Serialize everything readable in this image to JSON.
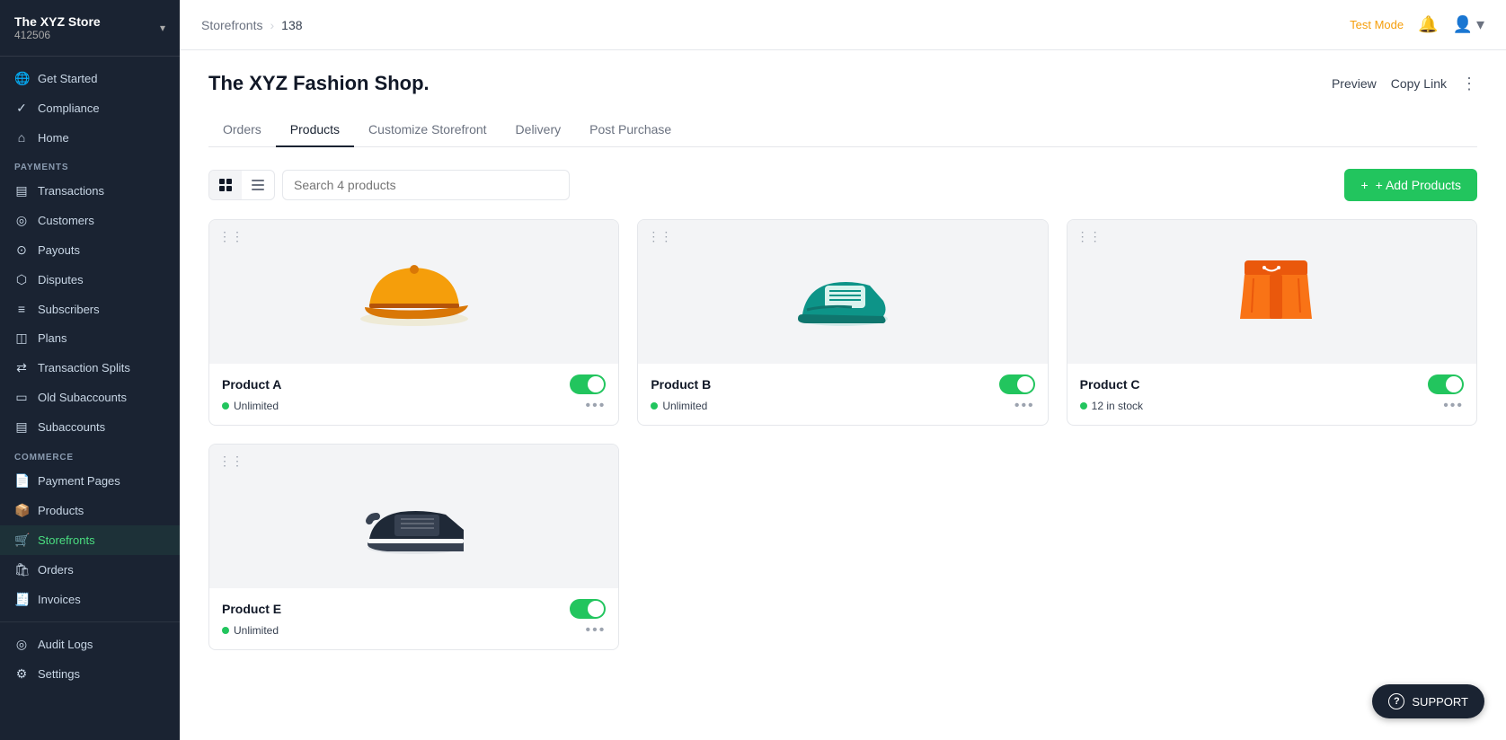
{
  "brand": {
    "name": "The XYZ Store",
    "id": "412506"
  },
  "sidebar": {
    "top_items": [
      {
        "id": "get-started",
        "label": "Get Started",
        "icon": "🌐"
      },
      {
        "id": "compliance",
        "label": "Compliance",
        "icon": "✓"
      },
      {
        "id": "home",
        "label": "Home",
        "icon": "⌂"
      }
    ],
    "payments_section": "PAYMENTS",
    "payments_items": [
      {
        "id": "transactions",
        "label": "Transactions",
        "icon": "💳"
      },
      {
        "id": "customers",
        "label": "Customers",
        "icon": "👤"
      },
      {
        "id": "payouts",
        "label": "Payouts",
        "icon": "💰"
      },
      {
        "id": "disputes",
        "label": "Disputes",
        "icon": "⚖"
      },
      {
        "id": "subscribers",
        "label": "Subscribers",
        "icon": "📋"
      },
      {
        "id": "plans",
        "label": "Plans",
        "icon": "📄"
      },
      {
        "id": "transaction-splits",
        "label": "Transaction Splits",
        "icon": "↔"
      },
      {
        "id": "old-subaccounts",
        "label": "Old Subaccounts",
        "icon": "📦"
      },
      {
        "id": "subaccounts",
        "label": "Subaccounts",
        "icon": "🗂"
      }
    ],
    "commerce_section": "COMMERCE",
    "commerce_items": [
      {
        "id": "payment-pages",
        "label": "Payment Pages",
        "icon": "📄"
      },
      {
        "id": "products",
        "label": "Products",
        "icon": "📦"
      },
      {
        "id": "storefronts",
        "label": "Storefronts",
        "icon": "🛒",
        "active": true
      },
      {
        "id": "orders",
        "label": "Orders",
        "icon": "🛍"
      },
      {
        "id": "invoices",
        "label": "Invoices",
        "icon": "🧾"
      }
    ],
    "footer_items": [
      {
        "id": "audit-logs",
        "label": "Audit Logs",
        "icon": "📋"
      },
      {
        "id": "settings",
        "label": "Settings",
        "icon": "⚙"
      }
    ]
  },
  "topbar": {
    "breadcrumb_parent": "Storefronts",
    "breadcrumb_sep": "›",
    "breadcrumb_current": "138",
    "test_mode": "Test Mode",
    "bell_icon": "🔔",
    "user_icon": "👤"
  },
  "page": {
    "title": "The XYZ Fashion Shop.",
    "preview_label": "Preview",
    "copy_link_label": "Copy Link",
    "tabs": [
      {
        "id": "orders",
        "label": "Orders",
        "active": false
      },
      {
        "id": "products",
        "label": "Products",
        "active": true
      },
      {
        "id": "customize-storefront",
        "label": "Customize Storefront",
        "active": false
      },
      {
        "id": "delivery",
        "label": "Delivery",
        "active": false
      },
      {
        "id": "post-purchase",
        "label": "Post Purchase",
        "active": false
      }
    ],
    "search_placeholder": "Search 4 products",
    "add_products_label": "+ Add Products"
  },
  "products": [
    {
      "id": "product-a",
      "name": "Product A",
      "stock_label": "Unlimited",
      "enabled": true,
      "emoji": "🧢",
      "emoji_color": "#f59e0b"
    },
    {
      "id": "product-b",
      "name": "Product B",
      "stock_label": "Unlimited",
      "enabled": true,
      "emoji": "👟",
      "emoji_color": "#0ea5e9"
    },
    {
      "id": "product-c",
      "name": "Product C",
      "stock_label": "12 in stock",
      "enabled": true,
      "emoji": "🩳",
      "emoji_color": "#f97316"
    },
    {
      "id": "product-e",
      "name": "Product E",
      "stock_label": "Unlimited",
      "enabled": true,
      "emoji": "👟",
      "emoji_color": "#111827"
    }
  ],
  "support": {
    "label": "SUPPORT",
    "icon": "?"
  }
}
